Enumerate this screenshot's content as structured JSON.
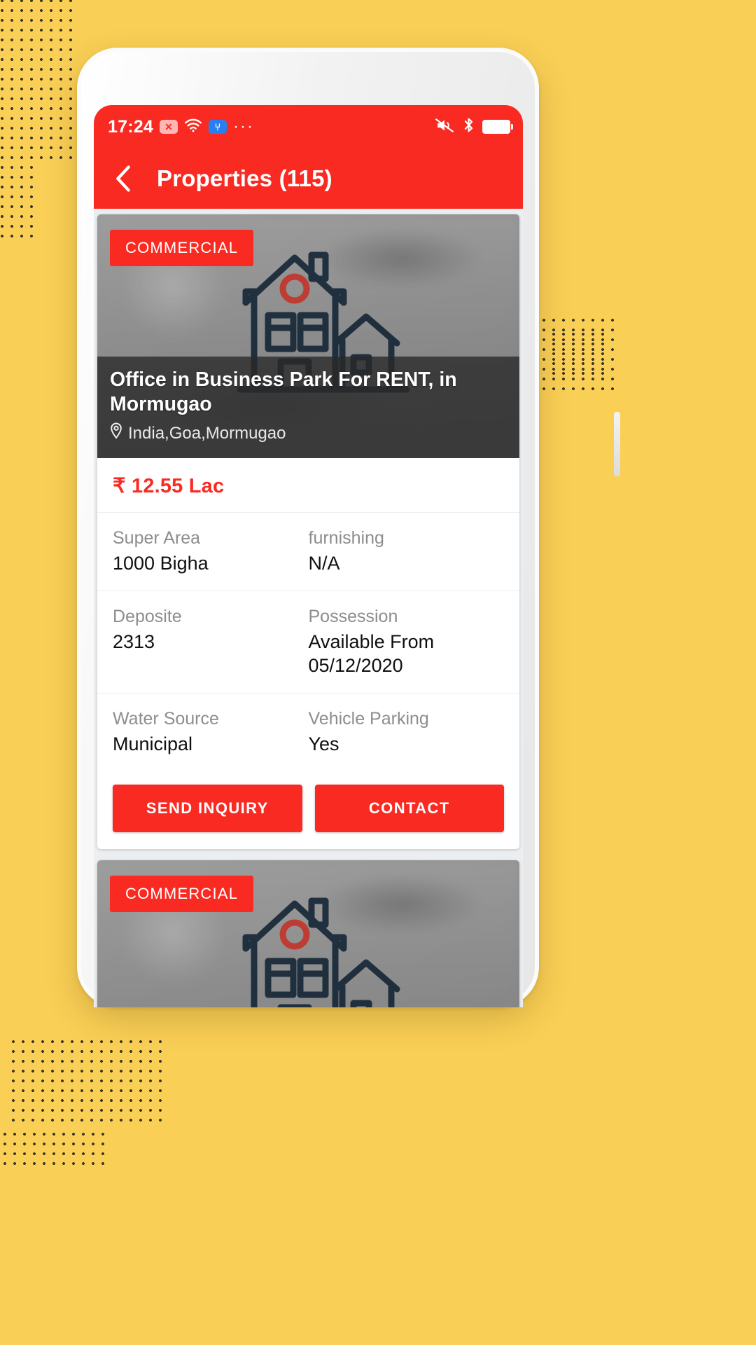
{
  "theme": {
    "brand_red": "#F92A22",
    "backdrop_yellow": "#F9CF55",
    "overlay_dark": "#2b2b2b"
  },
  "status_bar": {
    "time": "17:24",
    "no_sim_icon": "no-sim-icon",
    "no_sim_glyph": "✕",
    "wifi_icon": "wifi-icon",
    "usb_icon": "usb-icon",
    "usb_glyph": "⑂",
    "overflow_glyph": "···",
    "mute_icon": "volume-mute-icon",
    "bluetooth_icon": "bluetooth-icon",
    "bluetooth_glyph": "ᛦ",
    "battery_icon": "battery-full-icon"
  },
  "app_bar": {
    "back_label": "back-arrow",
    "title": "Properties (115)"
  },
  "cards": [
    {
      "badge": "COMMERCIAL",
      "title": "Office in Business Park For  RENT, in Mormugao",
      "location": "India,Goa,Mormugao",
      "location_pin_icon": "map-pin-icon",
      "price": "₹ 12.55 Lac",
      "specs": [
        {
          "label": "Super Area",
          "value": "1000 Bigha"
        },
        {
          "label": "furnishing",
          "value": "N/A"
        },
        {
          "label": "Deposite",
          "value": "2313"
        },
        {
          "label": "Possession",
          "value": "Available From 05/12/2020"
        },
        {
          "label": "Water Source",
          "value": "Municipal"
        },
        {
          "label": "Vehicle Parking",
          "value": "Yes"
        }
      ],
      "primary_button": "SEND INQUIRY",
      "secondary_button": "CONTACT"
    },
    {
      "badge": "COMMERCIAL"
    }
  ]
}
